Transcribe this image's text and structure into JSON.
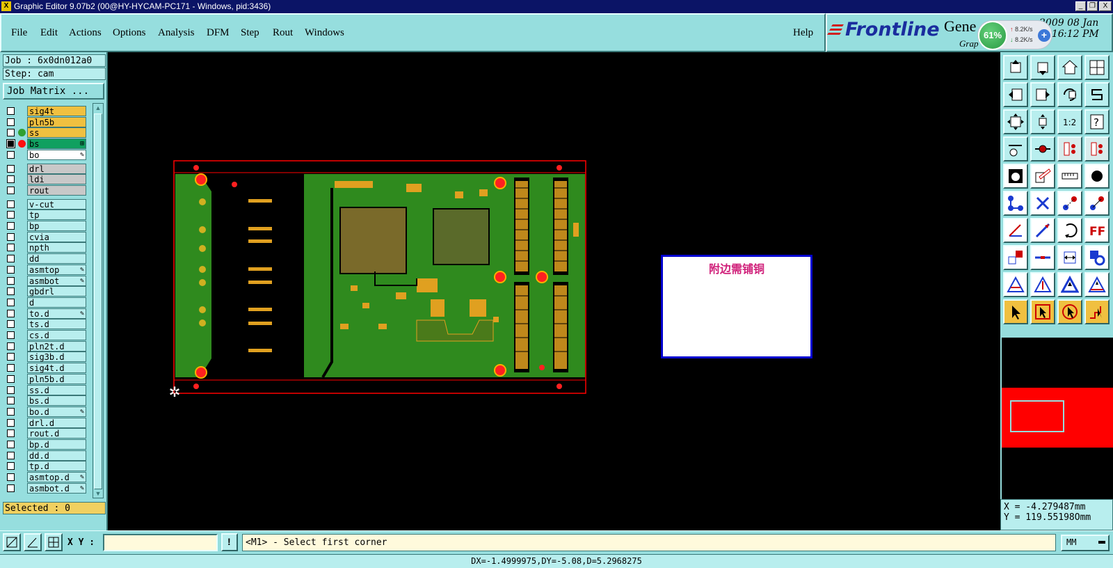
{
  "window": {
    "title": "Graphic Editor 9.07b2 (00@HY-HYCAM-PC171 - Windows, pid:3436)",
    "app_icon_glyph": "X",
    "buttons": {
      "minimize": "_",
      "restore": "❐",
      "close": "X"
    }
  },
  "menu": {
    "items": [
      "File",
      "Edit",
      "Actions",
      "Options",
      "Analysis",
      "DFM",
      "Step",
      "Rout",
      "Windows"
    ],
    "help": "Help"
  },
  "brand": {
    "logo": "Frontline",
    "product": "Gene",
    "product_sub": "Grap",
    "date": "2009 08 Jan 2016",
    "time": ":12 PM"
  },
  "network_widget": {
    "percent": "61%",
    "up_rate": "8.2K/s",
    "down_rate": "8.2K/s",
    "up_arrow": "↑",
    "down_arrow": "↓",
    "plus": "+"
  },
  "job": {
    "job_label": "Job : 6x0dn012a0",
    "step_label": "Step: cam",
    "matrix_button": "Job Matrix ..."
  },
  "layers": [
    {
      "name": "sig4t",
      "color": "#f0c040",
      "dot": null,
      "checked": false,
      "mark": ""
    },
    {
      "name": "pln5b",
      "color": "#f0c040",
      "dot": null,
      "checked": false,
      "mark": ""
    },
    {
      "name": "ss",
      "color": "#f0c040",
      "dot": "#30a030",
      "checked": false,
      "mark": ""
    },
    {
      "name": "bs",
      "color": "#10a060",
      "dot": "#ff1010",
      "checked": true,
      "mark": "⊞"
    },
    {
      "name": "bo",
      "color": "#ffffff",
      "dot": null,
      "checked": false,
      "mark": "✎"
    },
    {
      "name": "drl",
      "color": "#c8c8c8",
      "dot": null,
      "checked": false,
      "mark": "",
      "gap": true
    },
    {
      "name": "ldi",
      "color": "#c8c8c8",
      "dot": null,
      "checked": false,
      "mark": ""
    },
    {
      "name": "rout",
      "color": "#c8c8c8",
      "dot": null,
      "checked": false,
      "mark": ""
    },
    {
      "name": "v-cut",
      "color": "#b8eeee",
      "dot": null,
      "checked": false,
      "mark": "",
      "gap": true
    },
    {
      "name": "tp",
      "color": "#b8eeee",
      "dot": null,
      "checked": false,
      "mark": ""
    },
    {
      "name": "bp",
      "color": "#b8eeee",
      "dot": null,
      "checked": false,
      "mark": ""
    },
    {
      "name": "cvia",
      "color": "#b8eeee",
      "dot": null,
      "checked": false,
      "mark": ""
    },
    {
      "name": "npth",
      "color": "#b8eeee",
      "dot": null,
      "checked": false,
      "mark": ""
    },
    {
      "name": "dd",
      "color": "#b8eeee",
      "dot": null,
      "checked": false,
      "mark": ""
    },
    {
      "name": "asmtop",
      "color": "#b8eeee",
      "dot": null,
      "checked": false,
      "mark": "✎"
    },
    {
      "name": "asmbot",
      "color": "#b8eeee",
      "dot": null,
      "checked": false,
      "mark": "✎"
    },
    {
      "name": "gbdrl",
      "color": "#b8eeee",
      "dot": null,
      "checked": false,
      "mark": ""
    },
    {
      "name": "d",
      "color": "#b8eeee",
      "dot": null,
      "checked": false,
      "mark": ""
    },
    {
      "name": "to.d",
      "color": "#b8eeee",
      "dot": null,
      "checked": false,
      "mark": "✎"
    },
    {
      "name": "ts.d",
      "color": "#b8eeee",
      "dot": null,
      "checked": false,
      "mark": ""
    },
    {
      "name": "cs.d",
      "color": "#b8eeee",
      "dot": null,
      "checked": false,
      "mark": ""
    },
    {
      "name": "pln2t.d",
      "color": "#b8eeee",
      "dot": null,
      "checked": false,
      "mark": ""
    },
    {
      "name": "sig3b.d",
      "color": "#b8eeee",
      "dot": null,
      "checked": false,
      "mark": ""
    },
    {
      "name": "sig4t.d",
      "color": "#b8eeee",
      "dot": null,
      "checked": false,
      "mark": ""
    },
    {
      "name": "pln5b.d",
      "color": "#b8eeee",
      "dot": null,
      "checked": false,
      "mark": ""
    },
    {
      "name": "ss.d",
      "color": "#b8eeee",
      "dot": null,
      "checked": false,
      "mark": ""
    },
    {
      "name": "bs.d",
      "color": "#b8eeee",
      "dot": null,
      "checked": false,
      "mark": ""
    },
    {
      "name": "bo.d",
      "color": "#b8eeee",
      "dot": null,
      "checked": false,
      "mark": "✎"
    },
    {
      "name": "drl.d",
      "color": "#b8eeee",
      "dot": null,
      "checked": false,
      "mark": ""
    },
    {
      "name": "rout.d",
      "color": "#b8eeee",
      "dot": null,
      "checked": false,
      "mark": ""
    },
    {
      "name": "bp.d",
      "color": "#b8eeee",
      "dot": null,
      "checked": false,
      "mark": ""
    },
    {
      "name": "dd.d",
      "color": "#b8eeee",
      "dot": null,
      "checked": false,
      "mark": ""
    },
    {
      "name": "tp.d",
      "color": "#b8eeee",
      "dot": null,
      "checked": false,
      "mark": ""
    },
    {
      "name": "asmtop.d",
      "color": "#b8eeee",
      "dot": null,
      "checked": false,
      "mark": "✎"
    },
    {
      "name": "asmbot.d",
      "color": "#b8eeee",
      "dot": null,
      "checked": false,
      "mark": "✎"
    }
  ],
  "selected": "Selected : 0",
  "canvas": {
    "note_text": "附边需铺铜",
    "origin_glyph": "✲"
  },
  "coords": {
    "x": "X = -4.279487mm",
    "y": "Y = 119.55198Omm"
  },
  "bottom": {
    "xy_label": "X Y :",
    "xy_value": "",
    "prompt": "<M1> - Select first corner",
    "units": "MM",
    "alert_glyph": "!"
  },
  "status": "DX=-1.4999975,DY=-5.08,D=5.2968275",
  "colors": {
    "panel": "#96dede",
    "panel_light": "#b8eeee",
    "title_bg": "#0b1466",
    "pcb_green": "#2f8a1e",
    "pad_orange": "#e0a020",
    "board_outline": "#ff0000"
  },
  "tool_icons": [
    "zoom-home-icon",
    "zoom-out-icon",
    "home-icon",
    "pan-icon",
    "pan-left-icon",
    "pan-right-icon",
    "undo-view-icon",
    "redraw-icon",
    "zoom-fit-icon",
    "zoom-center-icon",
    "zoom-1to2-icon",
    "help-icon",
    "measure-icon",
    "snap-icon",
    "layer-compare-icon",
    "layer-swap-icon",
    "select-circle-icon",
    "copy-icon",
    "ruler-icon",
    "pad-icon",
    "connect-icon",
    "delete-icon",
    "move-icon",
    "move-copy-icon",
    "line-icon",
    "arc-icon",
    "rotate-icon",
    "mirror-icon",
    "add-feature-icon",
    "split-icon",
    "resize-icon",
    "shapes-icon",
    "triangle-a-icon",
    "triangle-b-icon",
    "triangle-c-icon",
    "triangle-d-icon",
    "pointer-icon",
    "pointer-box-icon",
    "pointer-circle-icon",
    "pointer-route-icon"
  ]
}
